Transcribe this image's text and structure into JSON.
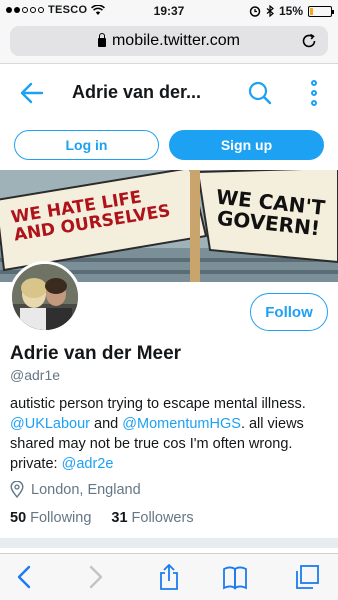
{
  "status_bar": {
    "carrier": "TESCO",
    "time": "19:37",
    "battery": "15%",
    "battery_level": 0.15
  },
  "browser": {
    "url": "mobile.twitter.com"
  },
  "header": {
    "title": "Adrie van der..."
  },
  "auth": {
    "login_label": "Log in",
    "signup_label": "Sign up"
  },
  "banner": {
    "left_sign_line1": "We hate life",
    "left_sign_line2": "and ourselves",
    "right_sign_line1": "We can't",
    "right_sign_line2": "govern!"
  },
  "profile": {
    "follow_label": "Follow",
    "name": "Adrie van der Meer",
    "handle": "@adr1e",
    "bio_part1": "autistic person trying to escape mental illness. ",
    "bio_mention1": "@UKLabour",
    "bio_part2": " and ",
    "bio_mention2": "@MomentumHGS",
    "bio_part3": ". all views shared may not be true cos I'm often wrong. private: ",
    "bio_mention3": "@adr2e",
    "location": "London, England",
    "following_count": "50",
    "following_label": "Following",
    "followers_count": "31",
    "followers_label": "Followers"
  },
  "colors": {
    "twitter_blue": "#1da1f2",
    "secondary_text": "#657786"
  }
}
